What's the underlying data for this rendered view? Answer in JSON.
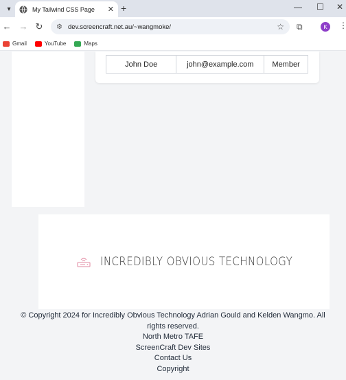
{
  "browser": {
    "tab_title": "My Tailwind CSS Page",
    "url": "dev.screencraft.net.au/~wangmoke/",
    "profile_initial": "K",
    "bookmarks": [
      {
        "label": "Gmail",
        "icon": "gmail-icon",
        "color": "#ea4335"
      },
      {
        "label": "YouTube",
        "icon": "youtube-icon",
        "color": "#ff0000"
      },
      {
        "label": "Maps",
        "icon": "maps-icon",
        "color": "#34a853"
      }
    ]
  },
  "table": {
    "rows": [
      {
        "name": "John Doe",
        "email": "john@example.com",
        "role": "Member"
      }
    ]
  },
  "banner": {
    "logo_text": "INCREDIBLY OBVIOUS TECHNOLOGY",
    "accent": "#e8a0b4"
  },
  "footer": {
    "copyright": "© Copyright 2024 for Incredibly Obvious Technology Adrian Gould and Kelden Wangmo. All rights reserved.",
    "links": [
      "North Metro TAFE",
      "ScreenCraft Dev Sites",
      "Contact Us",
      "Copyright"
    ]
  }
}
